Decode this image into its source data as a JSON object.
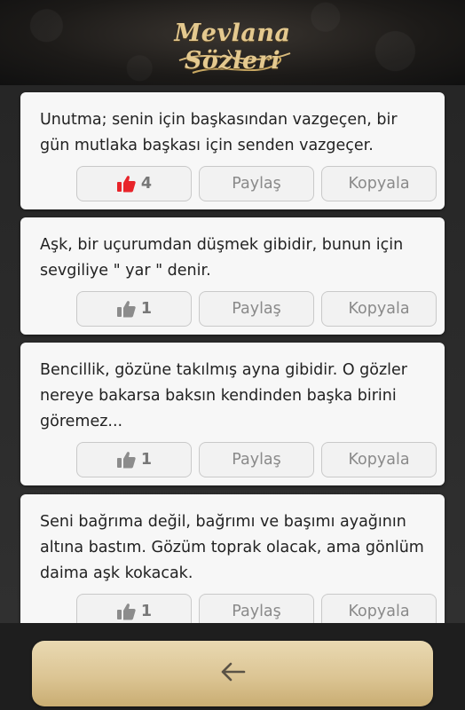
{
  "header": {
    "logo_text": "Mevlana Sözleri"
  },
  "colors": {
    "liked": "#e8242a",
    "unliked": "#8c8c8c",
    "gold": "#e4c98f"
  },
  "cards": [
    {
      "quote": "Unutma; senin için başkasından vazgeçen, bir gün mutlaka başkası için senden vazgeçer.",
      "likes": "4",
      "liked": true,
      "share_label": "Paylaş",
      "copy_label": "Kopyala"
    },
    {
      "quote": "Aşk, bir uçurumdan düşmek gibidir, bunun için sevgiliye \" yar \" denir.",
      "likes": "1",
      "liked": false,
      "share_label": "Paylaş",
      "copy_label": "Kopyala"
    },
    {
      "quote": "Bencillik, gözüne takılmış ayna gibidir. O gözler nereye bakarsa baksın kendinden başka birini göremez...",
      "likes": "1",
      "liked": false,
      "share_label": "Paylaş",
      "copy_label": "Kopyala"
    },
    {
      "quote": "Seni bağrıma değil, bağrımı ve başımı ayağının altına bastım. Gözüm toprak olacak, ama gönlüm daima aşk kokacak.",
      "likes": "1",
      "liked": false,
      "share_label": "Paylaş",
      "copy_label": "Kopyala"
    }
  ],
  "footer": {
    "back_icon": "arrow-left-icon"
  }
}
